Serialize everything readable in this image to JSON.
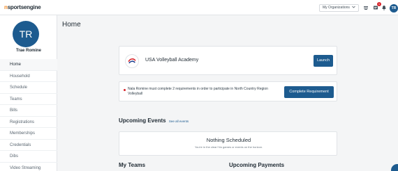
{
  "brand": {
    "n": "n",
    "rest": "sportsengine"
  },
  "topbar": {
    "org_select_label": "My Organizations",
    "messages_badge": "1",
    "avatar_initials": "TR"
  },
  "sidebar": {
    "avatar_initials": "TR",
    "user_name": "Trae Romine",
    "items": [
      {
        "label": "Home"
      },
      {
        "label": "Household"
      },
      {
        "label": "Schedule"
      },
      {
        "label": "Teams"
      },
      {
        "label": "Bills"
      },
      {
        "label": "Registrations"
      },
      {
        "label": "Memberships"
      },
      {
        "label": "Credentials"
      },
      {
        "label": "Dibs"
      },
      {
        "label": "Video Streaming"
      }
    ]
  },
  "main": {
    "title": "Home",
    "org_card": {
      "name": "USA Volleyball Academy",
      "launch_label": "Launch"
    },
    "requirement": {
      "text": "Nala Romine must complete 2 requirements in order to participate in North Country Region Volleyball",
      "button_label": "Complete Requirement"
    },
    "upcoming_events": {
      "title": "Upcoming Events",
      "see_all": "See all events",
      "empty_title": "Nothing Scheduled",
      "empty_sub": "You're in the clear! No games or events on the horizon."
    },
    "my_teams": {
      "title": "My Teams"
    },
    "upcoming_payments": {
      "title": "Upcoming Payments"
    }
  },
  "colors": {
    "accent": "#1d5b8f",
    "brand_orange": "#f28c28",
    "alert_red": "#d8232a",
    "background": "#f4f5f6"
  },
  "icons": [
    "chevron-down-icon",
    "chat-icon",
    "messages-icon",
    "bell-icon",
    "help-icon"
  ]
}
